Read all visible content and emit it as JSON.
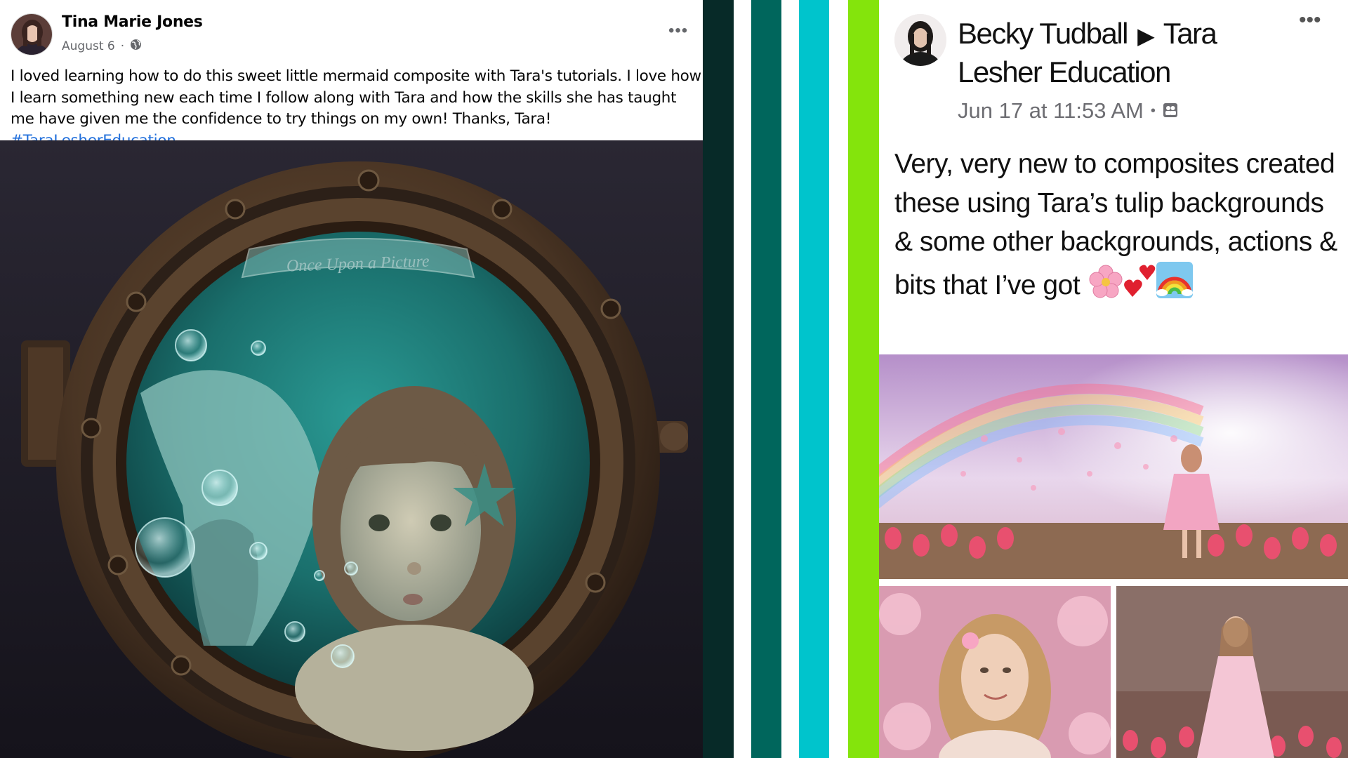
{
  "left_post": {
    "author": "Tina Marie Jones",
    "date": "August 6",
    "separator": "·",
    "privacy_icon": "globe-icon",
    "more_icon": "ellipsis-icon",
    "more_label": "•••",
    "body": "I loved learning how to do this sweet little mermaid composite with Tara's tutorials. I love how I learn something new each time I follow along with Tara and how the skills she has taught me have given me the confidence to try things on my own! Thanks, Tara! ",
    "hashtag": "#TaraLesherEducation",
    "image": {
      "watermark": "Once Upon a Picture"
    }
  },
  "stripes": {
    "colors": [
      "#072a28",
      "#ffffff",
      "#00665c",
      "#ffffff",
      "#00c4cc",
      "#ffffff",
      "#84e40c"
    ]
  },
  "right_post": {
    "author": "Becky Tudball",
    "arrow": "▶",
    "group": "Tara Lesher Education",
    "time": "Jun 17 at 11:53 AM",
    "separator": "•",
    "privacy_icon": "group-icon",
    "more_icon": "ellipsis-icon",
    "more_label": "•••",
    "body": "Very, very new to composites created these using Tara’s tulip backgrounds & some other backgrounds, actions & bits that I’ve got",
    "emojis": [
      "cherry-blossom-emoji",
      "two-hearts-emoji",
      "rainbow-emoji"
    ]
  },
  "colors": {
    "facebook_blue": "#216fdb",
    "meta_grey": "#65676b",
    "lime": "#84e40c",
    "teal": "#00665c",
    "cyan": "#00c4cc"
  }
}
